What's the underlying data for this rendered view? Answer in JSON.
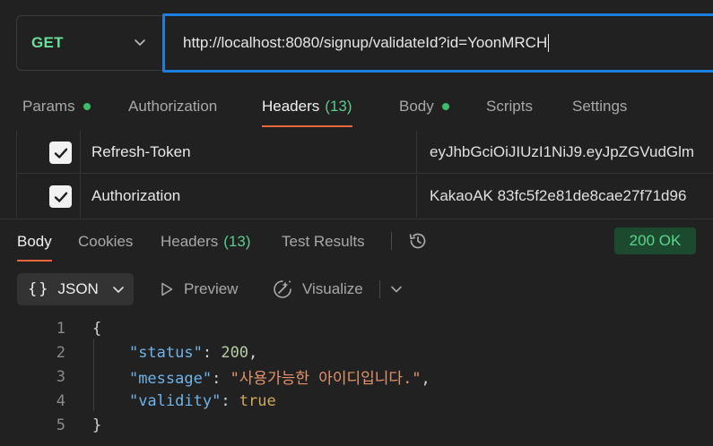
{
  "request": {
    "method": "GET",
    "url": "http://localhost:8080/signup/validateId?id=YoonMRCH"
  },
  "request_tabs": {
    "params": "Params",
    "authorization": "Authorization",
    "headers": "Headers",
    "headers_count": "(13)",
    "body": "Body",
    "scripts": "Scripts",
    "settings": "Settings"
  },
  "headers_table": {
    "rows": [
      {
        "key": "Refresh-Token",
        "value": "eyJhbGciOiJIUzI1NiJ9.eyJpZGVudGlm"
      },
      {
        "key": "Authorization",
        "value": "KakaoAK 83fc5f2e81de8cae27f71d96"
      }
    ]
  },
  "response_tabs": {
    "body": "Body",
    "cookies": "Cookies",
    "headers": "Headers",
    "headers_count": "(13)",
    "test_results": "Test Results"
  },
  "status": {
    "text": "200 OK"
  },
  "response_toolbar": {
    "format_braces": "{}",
    "format": "JSON",
    "preview": "Preview",
    "visualize": "Visualize"
  },
  "code": {
    "line_numbers": [
      "1",
      "2",
      "3",
      "4",
      "5"
    ],
    "open_brace": "{",
    "close_brace": "}",
    "status_key": "\"status\"",
    "status_value": "200",
    "message_key": "\"message\"",
    "message_value": "\"사용가능한 아이디입니다.\"",
    "validity_key": "\"validity\"",
    "validity_value": "true"
  },
  "colors": {
    "accent_focus": "#1a7fe0",
    "tab_underline": "#e8683b",
    "method_get": "#6bdd9a",
    "status_ok_bg": "#1c4a2e",
    "status_ok_text": "#5ad68c",
    "enabled_dot": "#3dbb6b"
  },
  "icons": {
    "method_dropdown": "chevron-down-icon",
    "checkbox": "checkmark-icon",
    "history": "history-icon",
    "format_dropdown": "chevron-down-icon",
    "preview": "play-icon",
    "visualize": "visualize-icon",
    "more": "chevron-down-icon"
  }
}
